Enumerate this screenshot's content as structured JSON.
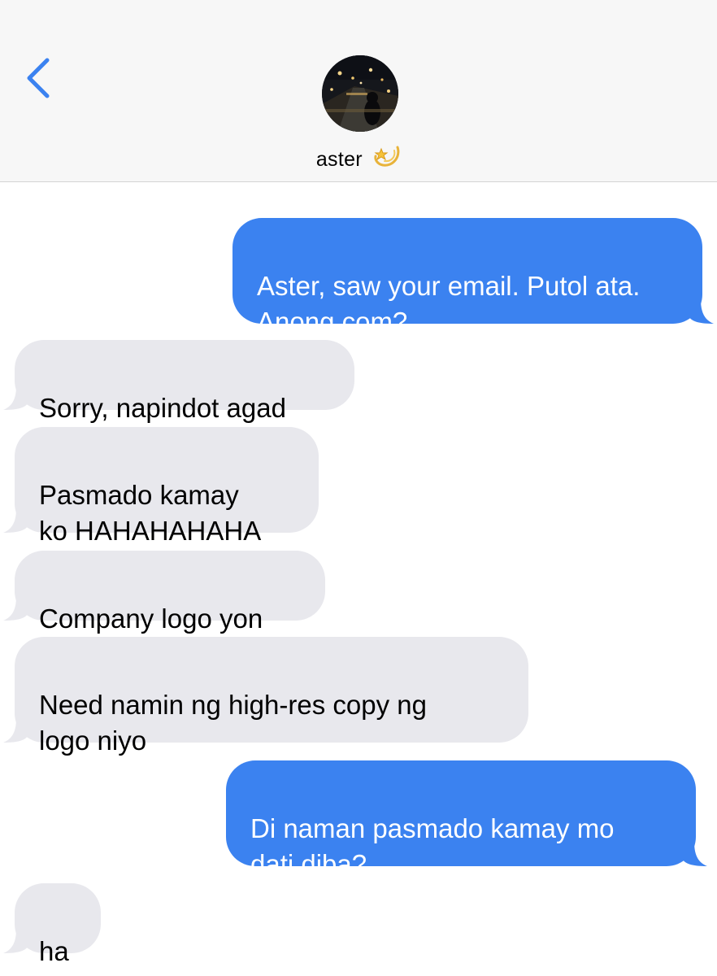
{
  "header": {
    "back_icon": "chevron-left-icon",
    "contact_name": "aster",
    "contact_emoji": "💫",
    "avatar_icon": "contact-photo"
  },
  "colors": {
    "accent": "#3b82f0",
    "outgoing_bubble": "#3b82f0",
    "incoming_bubble": "#e8e8ed",
    "header_bg": "#f7f7f7"
  },
  "messages": [
    {
      "direction": "outgoing",
      "text": "Aster, saw your email. Putol ata.\nAnong com?"
    },
    {
      "direction": "incoming",
      "text": "Sorry, napindot agad"
    },
    {
      "direction": "incoming",
      "text": "Pasmado kamay\nko HAHAHAHAHA"
    },
    {
      "direction": "incoming",
      "text": "Company logo yon"
    },
    {
      "direction": "incoming",
      "text": "Need namin ng high-res copy ng\nlogo niyo"
    },
    {
      "direction": "outgoing",
      "text": "Di naman pasmado kamay mo\ndati diba?"
    },
    {
      "direction": "incoming",
      "text": "ha"
    }
  ]
}
